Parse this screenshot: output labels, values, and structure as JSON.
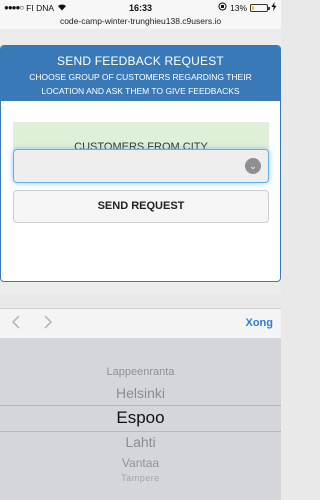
{
  "status_bar": {
    "carrier": "FI DNA",
    "time": "16:33",
    "battery_percent": "13%",
    "battery_level": 0.13,
    "battery_color": "#f0c419"
  },
  "url_bar": {
    "url": "code-camp-winter-trunghieu138.c9users.io"
  },
  "feedback_card": {
    "title": "SEND FEEDBACK REQUEST",
    "subtitle": "CHOOSE GROUP OF CUSTOMERS REGARDING THEIR LOCATION AND ASK THEM TO GIVE FEEDBACKS",
    "header_color": "#3a79b8",
    "group_label": "CUSTOMERS FROM CITY",
    "select_value": "",
    "send_button": "SEND REQUEST"
  },
  "accessory_bar": {
    "prev_icon": "chevron-left-icon",
    "next_icon": "chevron-right-icon",
    "done_label": "Xong"
  },
  "picker": {
    "options": [
      "Lappeenranta",
      "Helsinki",
      "Espoo",
      "Lahti",
      "Vantaa",
      "Tampere"
    ],
    "selected": "Espoo"
  }
}
